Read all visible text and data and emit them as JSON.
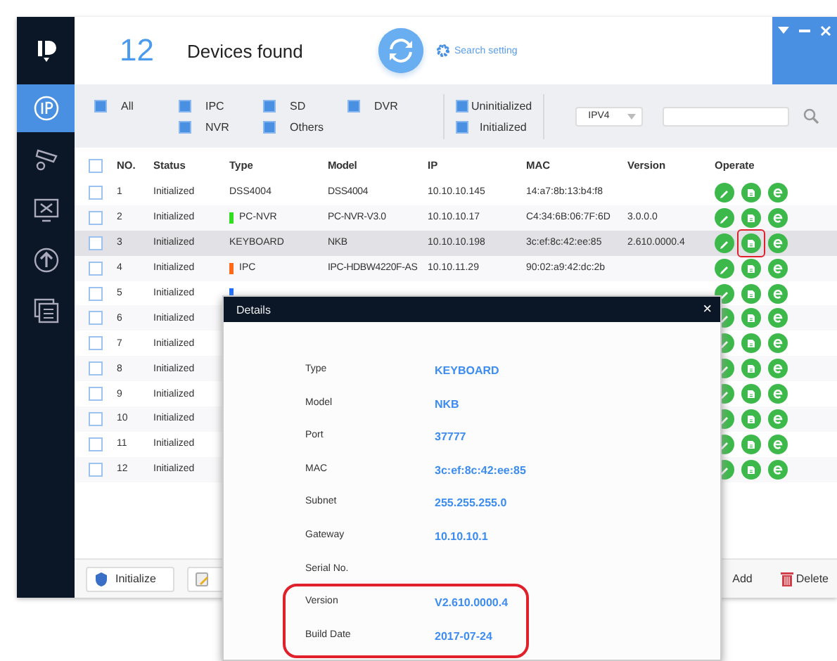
{
  "sidebar": {
    "items": [
      {
        "kind": "ip",
        "selected": true
      },
      {
        "kind": "camera",
        "selected": false
      },
      {
        "kind": "tools",
        "selected": false
      },
      {
        "kind": "upgrade",
        "selected": false
      },
      {
        "kind": "windows",
        "selected": false
      }
    ]
  },
  "header": {
    "count": "12",
    "title": "Devices found",
    "search_setting": "Search setting"
  },
  "filters": {
    "types": [
      {
        "label": "All",
        "checked": true
      },
      {
        "label": "IPC",
        "checked": true
      },
      {
        "label": "SD",
        "checked": true
      },
      {
        "label": "DVR",
        "checked": true
      },
      {
        "label": "NVR",
        "checked": true
      },
      {
        "label": "Others",
        "checked": true
      }
    ],
    "status": [
      {
        "label": "Uninitialized",
        "checked": true
      },
      {
        "label": "Initialized",
        "checked": true
      }
    ],
    "ip_version": "IPV4"
  },
  "table": {
    "select_all_checked": false,
    "columns": [
      "NO.",
      "Status",
      "Type",
      "Model",
      "IP",
      "MAC",
      "Version",
      "Operate"
    ],
    "rows": [
      {
        "no": "1",
        "status": "Initialized",
        "type": "DSS4004",
        "model": "DSS4004",
        "ip": "10.10.10.145",
        "mac": "14:a7:8b:13:b4:f8",
        "checked": false,
        "selected": false,
        "annotated": false
      },
      {
        "no": "2",
        "status": "Initialized",
        "type": "PC-NVR",
        "color": "#33dd22",
        "model": "PC-NVR-V3.0",
        "ip": "10.10.10.17",
        "mac": "C4:34:6B:06:7F:6D",
        "version": "3.0.0.0",
        "checked": false,
        "selected": false,
        "annotated": false
      },
      {
        "no": "3",
        "status": "Initialized",
        "type": "KEYBOARD",
        "model": "NKB",
        "ip": "10.10.10.198",
        "mac": "3c:ef:8c:42:ee:85",
        "version": "2.610.0000.4",
        "checked": false,
        "selected": true,
        "annotated": true
      },
      {
        "no": "4",
        "status": "Initialized",
        "type": "IPC",
        "color": "#ff6a1a",
        "model": "IPC-HDBW4220F-AS",
        "ip": "10.10.11.29",
        "mac": "90:02:a9:42:dc:2b",
        "checked": false,
        "selected": false,
        "annotated": false
      },
      {
        "no": "5",
        "status": "Initialized",
        "color": "#1a6cff",
        "checked": false,
        "selected": false,
        "annotated": false
      },
      {
        "no": "6",
        "status": "Initialized",
        "checked": false,
        "selected": false,
        "annotated": false
      },
      {
        "no": "7",
        "status": "Initialized",
        "checked": false,
        "selected": false,
        "annotated": false
      },
      {
        "no": "8",
        "status": "Initialized",
        "checked": false,
        "selected": false,
        "annotated": false
      },
      {
        "no": "9",
        "status": "Initialized",
        "checked": false,
        "selected": false,
        "annotated": false
      },
      {
        "no": "10",
        "status": "Initialized",
        "checked": false,
        "selected": false,
        "annotated": false
      },
      {
        "no": "11",
        "status": "Initialized",
        "checked": false,
        "selected": false,
        "annotated": false
      },
      {
        "no": "12",
        "status": "Initialized",
        "checked": false,
        "selected": false,
        "annotated": false
      }
    ]
  },
  "toolbar": {
    "initialize": "Initialize",
    "add": "Add",
    "delete": "Delete"
  },
  "dialog": {
    "title": "Details",
    "close": "×",
    "fields": [
      {
        "label": "Type",
        "value": "KEYBOARD",
        "annotated": false
      },
      {
        "label": "Model",
        "value": "NKB",
        "annotated": false
      },
      {
        "label": "Port",
        "value": "37777",
        "annotated": false
      },
      {
        "label": "MAC",
        "value": "3c:ef:8c:42:ee:85",
        "annotated": false
      },
      {
        "label": "Subnet",
        "value": "255.255.255.0",
        "annotated": false
      },
      {
        "label": "Gateway",
        "value": "10.10.10.1",
        "annotated": false
      },
      {
        "label": "Serial No.",
        "annotated": false
      },
      {
        "label": "Version",
        "value": "V2.610.0000.4",
        "annotated": true
      },
      {
        "label": "Build Date",
        "value": "2017-07-24",
        "annotated": true
      }
    ]
  }
}
